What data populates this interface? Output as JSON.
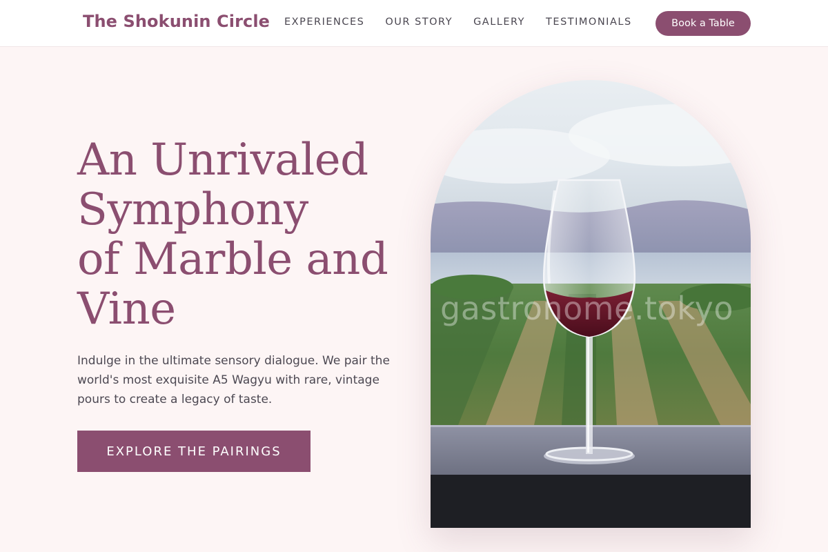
{
  "header": {
    "logo": "The Shokunin Circle",
    "nav": [
      "EXPERIENCES",
      "OUR STORY",
      "GALLERY",
      "TESTIMONIALS"
    ],
    "book_button": "Book a Table"
  },
  "hero": {
    "title_lines": [
      "An Unrivaled",
      "Symphony",
      "of Marble and",
      "Vine"
    ],
    "description": "Indulge in the ultimate sensory dialogue. We pair the world's most exquisite A5 Wagyu with rare, vintage pours to create a legacy of taste.",
    "cta": "EXPLORE THE PAIRINGS"
  },
  "image": {
    "subject": "wine-glass-vineyard-photo",
    "watermark": "gastronome.tokyo"
  },
  "colors": {
    "brand": "#8b4e70",
    "background": "#fdf5f5",
    "header_bg": "#ffffff",
    "body_text": "#4c4852"
  }
}
